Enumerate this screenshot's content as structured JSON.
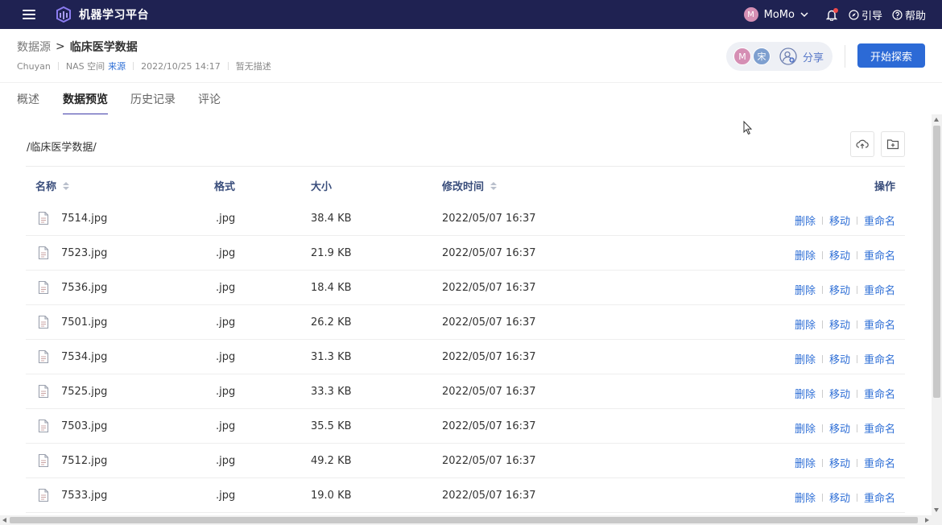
{
  "topbar": {
    "app_title": "机器学习平台",
    "user_initial": "M",
    "user_name": "MoMo",
    "guide_label": "引导",
    "help_label": "帮助",
    "has_notification": true
  },
  "header": {
    "breadcrumb_root": "数据源",
    "breadcrumb_sep": ">",
    "breadcrumb_current": "临床医学数据",
    "owner": "Chuyan",
    "storage": "NAS 空间",
    "source_link": "来源",
    "created_at": "2022/10/25 14:17",
    "description": "暂无描述",
    "collaborators": [
      "M",
      "宋"
    ],
    "share_label": "分享",
    "explore_button": "开始探索"
  },
  "tabs": [
    {
      "label": "概述",
      "active": false
    },
    {
      "label": "数据预览",
      "active": true
    },
    {
      "label": "历史记录",
      "active": false
    },
    {
      "label": "评论",
      "active": false
    }
  ],
  "browser": {
    "path": "/临床医学数据/",
    "columns": {
      "name": "名称",
      "format": "格式",
      "size": "大小",
      "modified": "修改时间",
      "actions": "操作"
    },
    "action_labels": {
      "delete": "删除",
      "move": "移动",
      "rename": "重命名"
    },
    "files": [
      {
        "name": "7514.jpg",
        "format": ".jpg",
        "size": "38.4 KB",
        "modified": "2022/05/07 16:37"
      },
      {
        "name": "7523.jpg",
        "format": ".jpg",
        "size": "21.9 KB",
        "modified": "2022/05/07 16:37"
      },
      {
        "name": "7536.jpg",
        "format": ".jpg",
        "size": "18.4 KB",
        "modified": "2022/05/07 16:37"
      },
      {
        "name": "7501.jpg",
        "format": ".jpg",
        "size": "26.2 KB",
        "modified": "2022/05/07 16:37"
      },
      {
        "name": "7534.jpg",
        "format": ".jpg",
        "size": "31.3 KB",
        "modified": "2022/05/07 16:37"
      },
      {
        "name": "7525.jpg",
        "format": ".jpg",
        "size": "33.3 KB",
        "modified": "2022/05/07 16:37"
      },
      {
        "name": "7503.jpg",
        "format": ".jpg",
        "size": "35.5 KB",
        "modified": "2022/05/07 16:37"
      },
      {
        "name": "7512.jpg",
        "format": ".jpg",
        "size": "49.2 KB",
        "modified": "2022/05/07 16:37"
      },
      {
        "name": "7533.jpg",
        "format": ".jpg",
        "size": "19.0 KB",
        "modified": "2022/05/07 16:37"
      }
    ]
  },
  "colors": {
    "topbar_bg": "#1f2252",
    "primary": "#2c6ad6",
    "link": "#2f6fd6",
    "tab_indicator": "#3d3aa8"
  }
}
